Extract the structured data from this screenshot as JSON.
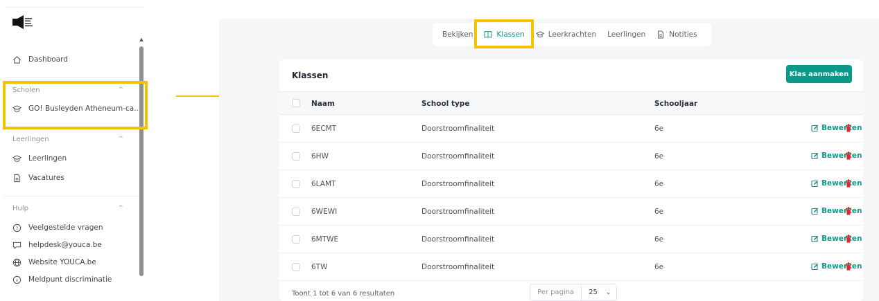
{
  "sidebar": {
    "dashboard": "Dashboard",
    "sections": [
      {
        "title": "Scholen",
        "items": [
          "GO! Busleyden Atheneum-ca..."
        ]
      },
      {
        "title": "Leerlingen",
        "items": [
          "Leerlingen",
          "Vacatures"
        ]
      },
      {
        "title": "Hulp",
        "items": [
          "Veelgestelde vragen",
          "helpdesk@youca.be",
          "Website YOUCA.be",
          "Meldpunt discriminatie"
        ]
      }
    ]
  },
  "tabs": [
    {
      "label": "Bekijken",
      "icon": "none",
      "active": false
    },
    {
      "label": "Klassen",
      "icon": "book-icon",
      "active": true
    },
    {
      "label": "Leerkrachten",
      "icon": "graduation-cap-icon",
      "active": false
    },
    {
      "label": "Leerlingen",
      "icon": "none",
      "active": false
    },
    {
      "label": "Notities",
      "icon": "document-icon",
      "active": false
    }
  ],
  "card": {
    "title": "Klassen",
    "create_button": "Klas aanmaken"
  },
  "table": {
    "columns": [
      "Naam",
      "School type",
      "Schooljaar"
    ],
    "rows": [
      {
        "naam": "6ECMT",
        "type": "Doorstroomfinaliteit",
        "jaar": "6e"
      },
      {
        "naam": "6HW",
        "type": "Doorstroomfinaliteit",
        "jaar": "6e"
      },
      {
        "naam": "6LAMT",
        "type": "Doorstroomfinaliteit",
        "jaar": "6e"
      },
      {
        "naam": "6WEWI",
        "type": "Doorstroomfinaliteit",
        "jaar": "6e"
      },
      {
        "naam": "6MTWE",
        "type": "Doorstroomfinaliteit",
        "jaar": "6e"
      },
      {
        "naam": "6TW",
        "type": "Doorstroomfinaliteit",
        "jaar": "6e"
      }
    ],
    "edit_label": "Bewerken"
  },
  "pagination": {
    "summary": "Toont 1 tot 6 van 6 resultaten",
    "per_page_label": "Per pagina",
    "per_page_value": "25"
  },
  "colors": {
    "accent": "#0b9a8a",
    "highlight": "#f3c300",
    "danger": "#e0243a"
  }
}
